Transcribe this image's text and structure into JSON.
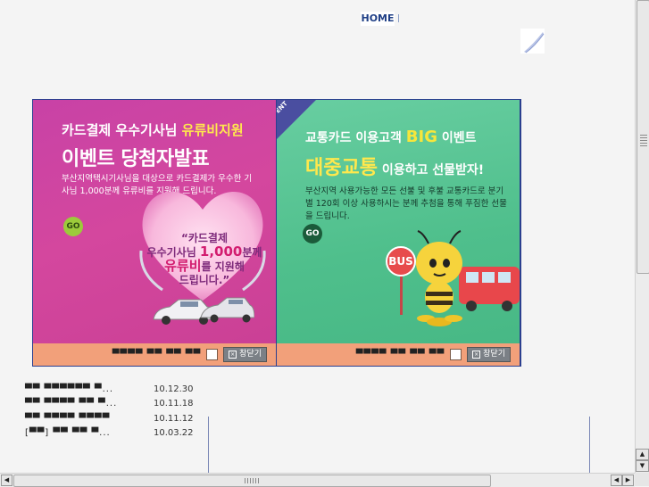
{
  "header": {
    "home_label": "HOME"
  },
  "popups": [
    {
      "title_line1_prefix": "카드결제 우수기사님 ",
      "title_line1_highlight": "유류비지원",
      "title_line2": "이벤트 당첨자발표",
      "description": "부산지역택시기사님을 대상으로 카드결제가 우수한 기사님 1,000분께 유류비를 지원해 드립니다.",
      "go_label": "GO",
      "heart_line1": "“카드결제",
      "heart_line2_a": "우수기사님 ",
      "heart_line2_big": "1,000",
      "heart_line2_b": "분께",
      "heart_line3_a": "유류비",
      "heart_line3_b": "를 지원",
      "heart_line3_c": "해",
      "heart_line4": "드립니다.”",
      "footer_text": "▀▀▀▀ ▀▀ ▀▀ ▀▀",
      "close_label": "창닫기"
    },
    {
      "event_tag": "EVENT",
      "title_line1_prefix": "교통카드 이용고객 ",
      "title_line1_highlight": "BIG",
      "title_line1_suffix": " 이벤트",
      "title_line2_big": "대중교통",
      "title_line2_sub": " 이용하고 선물받자!",
      "description": "부산지역 사용가능한 모든 선불 및 후불 교통카드로 분기별 120회 이상 사용하시는 분께 추첨을 통해 푸짐한 선물을 드립니다.",
      "go_label": "GO",
      "bus_sign": "BUS",
      "footer_text": "▀▀▀▀ ▀▀ ▀▀ ▀▀",
      "close_label": "창닫기"
    }
  ],
  "news": [
    {
      "title": "▀▀ ▀▀▀▀▀▀ ▀...",
      "date": "10.12.30"
    },
    {
      "title": "▀▀ ▀▀▀▀ ▀▀ ▀...",
      "date": "10.11.18"
    },
    {
      "title": "▀▀ ▀▀▀▀ ▀▀▀▀",
      "date": "10.11.12"
    },
    {
      "title": "[▀▀] ▀▀ ▀▀ ▀...",
      "date": "10.03.22"
    }
  ],
  "colors": {
    "home_text": "#1f3f86",
    "popup_border": "#2b3f8f",
    "left_panel": "#d4479e",
    "right_panel": "#4fbf8c",
    "footer_bar": "#f2a07a"
  }
}
